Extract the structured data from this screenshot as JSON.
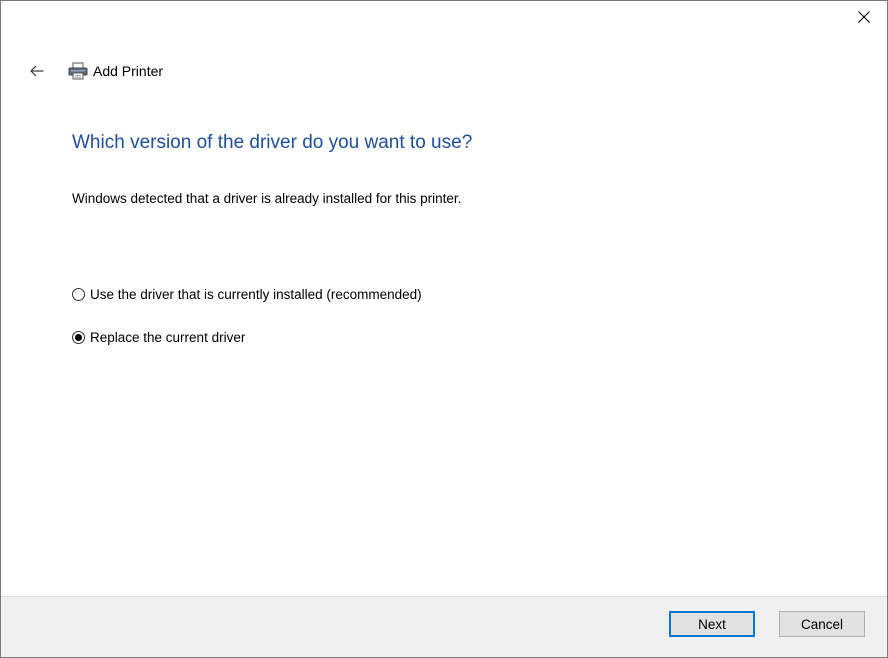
{
  "dialog": {
    "title": "Add Printer",
    "heading": "Which version of the driver do you want to use?",
    "description": "Windows detected that a driver is already installed for this printer.",
    "options": [
      {
        "label": "Use the driver that is currently installed (recommended)",
        "selected": false
      },
      {
        "label": "Replace the current driver",
        "selected": true
      }
    ]
  },
  "footer": {
    "next_label": "Next",
    "cancel_label": "Cancel"
  },
  "icons": {
    "close": "close-icon",
    "back": "back-arrow-icon",
    "printer": "printer-icon"
  },
  "colors": {
    "heading": "#1f4fa0",
    "default_button_border": "#0078d7",
    "footer_background": "#f0f0f0"
  }
}
